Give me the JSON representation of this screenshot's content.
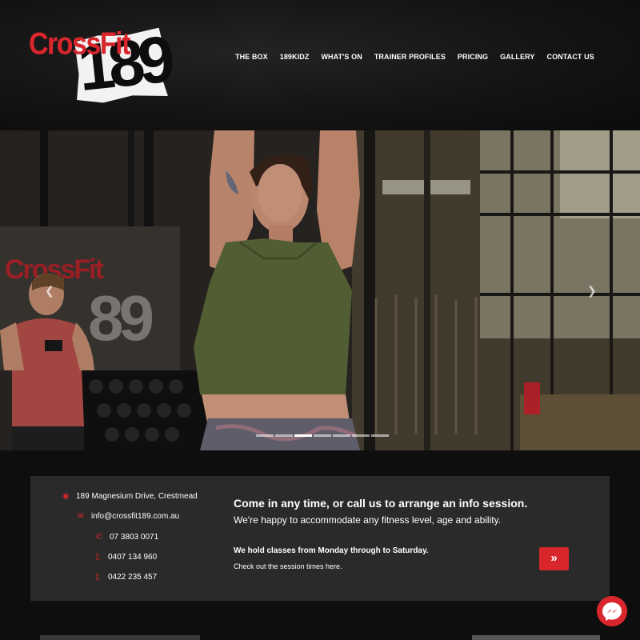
{
  "brand": {
    "name_red": "CrossFit",
    "name_num": "189"
  },
  "nav": {
    "items": [
      "THE BOX",
      "189KIDZ",
      "WHAT'S ON",
      "TRAINER PROFILES",
      "PRICING",
      "GALLERY",
      "CONTACT US"
    ]
  },
  "hero": {
    "wall_logo": "CrossFit",
    "prev_icon": "chevron-left-icon",
    "next_icon": "chevron-right-icon",
    "slide_count": 7,
    "active_slide": 2
  },
  "contact": {
    "address": "189 Magnesium Drive, Crestmead",
    "email": "info@crossfit189.com.au",
    "phone_landline": "07 3803 0071",
    "phone_mobile_1": "0407 134 960",
    "phone_mobile_2": "0422 235 457",
    "icons": [
      "map-pin-icon",
      "envelope-icon",
      "phone-icon",
      "mobile-icon",
      "mobile-icon"
    ]
  },
  "info": {
    "headline": "Come in any time, or call us to arrange an info session.",
    "subline": "We're happy to accommodate any fitness level, age and ability.",
    "classes": "We hold classes from Monday through to Saturday.",
    "session_link": "Check out the session times here.",
    "button_icon": "double-chevron-right-icon",
    "button_glyph": "»"
  },
  "colors": {
    "accent": "#d8262c",
    "panel": "#2a2a2a",
    "background": "#0d0d0d"
  }
}
